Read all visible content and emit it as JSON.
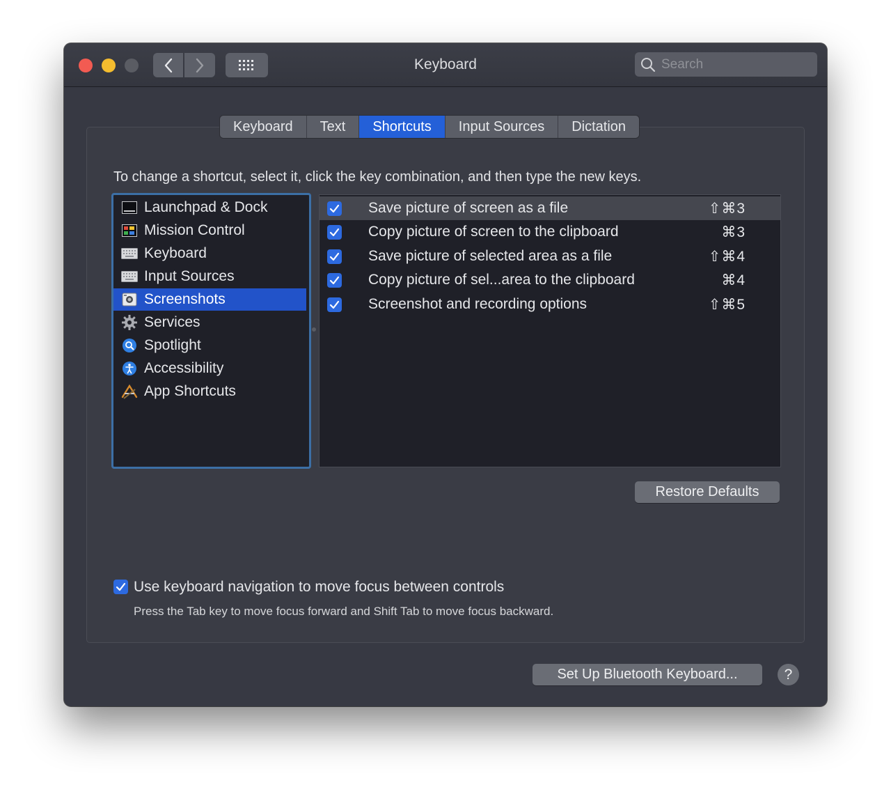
{
  "window": {
    "title": "Keyboard",
    "search_placeholder": "Search"
  },
  "tabs": [
    {
      "label": "Keyboard",
      "active": false
    },
    {
      "label": "Text",
      "active": false
    },
    {
      "label": "Shortcuts",
      "active": true
    },
    {
      "label": "Input Sources",
      "active": false
    },
    {
      "label": "Dictation",
      "active": false
    }
  ],
  "instruction": "To change a shortcut, select it, click the key combination, and then type the new keys.",
  "categories": [
    {
      "label": "Launchpad & Dock",
      "icon": "launchpad-dock-icon"
    },
    {
      "label": "Mission Control",
      "icon": "mission-control-icon"
    },
    {
      "label": "Keyboard",
      "icon": "keyboard-icon"
    },
    {
      "label": "Input Sources",
      "icon": "input-sources-icon"
    },
    {
      "label": "Screenshots",
      "icon": "screenshots-icon",
      "selected": true
    },
    {
      "label": "Services",
      "icon": "services-gear-icon"
    },
    {
      "label": "Spotlight",
      "icon": "spotlight-icon"
    },
    {
      "label": "Accessibility",
      "icon": "accessibility-icon"
    },
    {
      "label": "App Shortcuts",
      "icon": "app-shortcuts-icon"
    }
  ],
  "shortcuts": [
    {
      "label": "Save picture of screen as a file",
      "keys": "⇧⌘3",
      "checked": true,
      "selected": true
    },
    {
      "label": "Copy picture of screen to the clipboard",
      "keys": "⌘3",
      "checked": true
    },
    {
      "label": "Save picture of selected area as a file",
      "keys": "⇧⌘4",
      "checked": true
    },
    {
      "label": "Copy picture of sel...area to the clipboard",
      "keys": "⌘4",
      "checked": true
    },
    {
      "label": "Screenshot and recording options",
      "keys": "⇧⌘5",
      "checked": true
    }
  ],
  "restore_defaults": "Restore Defaults",
  "keyboard_navigation": {
    "checked": true,
    "label": "Use keyboard navigation to move focus between controls",
    "help": "Press the Tab key to move focus forward and Shift Tab to move focus backward."
  },
  "bluetooth_button": "Set Up Bluetooth Keyboard...",
  "help_button": "?",
  "colors": {
    "window_bg": "#373943",
    "accent": "#2460d8",
    "selection": "#2253c9",
    "list_bg": "#1f2028"
  }
}
